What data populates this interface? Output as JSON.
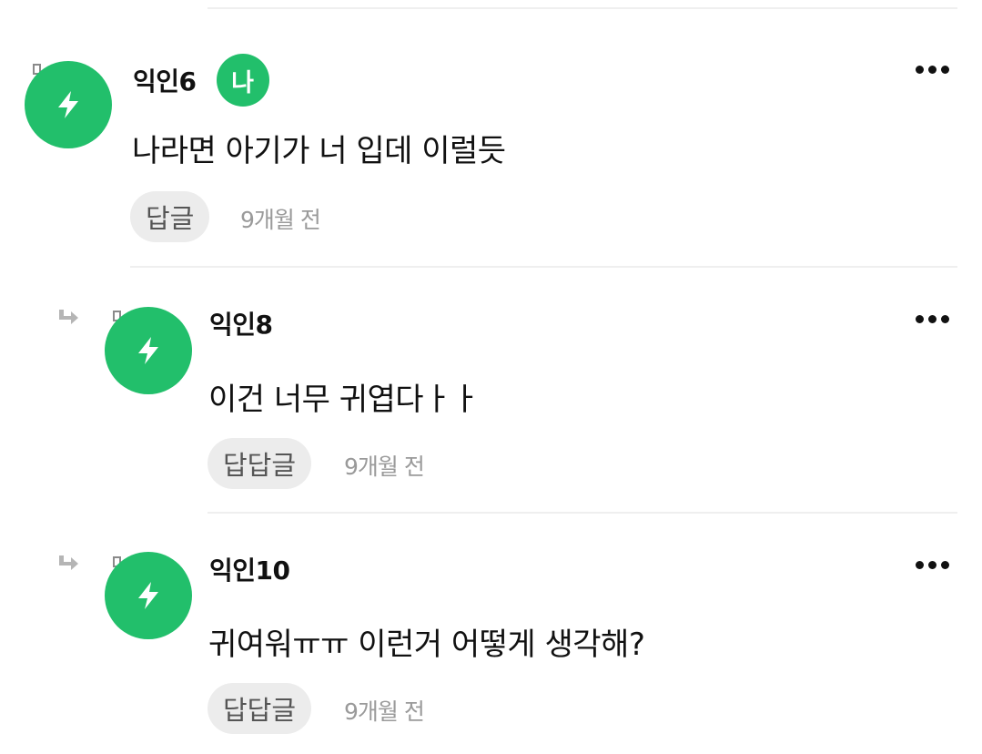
{
  "comments": [
    {
      "author": "익인6",
      "badge": "나",
      "text": "나라면 아기가 너 입데 이럴듯",
      "reply_label": "답글",
      "time": "9개월 전"
    },
    {
      "author": "익인8",
      "text": "이건 너무 귀엽다ㅏㅏ",
      "reply_label": "답답글",
      "time": "9개월 전"
    },
    {
      "author": "익인10",
      "text": "귀여워ㅠㅠ 이런거 어떻게 생각해?",
      "reply_label": "답답글",
      "time": "9개월 전"
    }
  ],
  "icons": {
    "avatar": "lightning-icon",
    "tag": "tag-icon",
    "reply_indicator": "reply-arrow-icon",
    "more": "more-dots-icon"
  },
  "colors": {
    "accent": "#22bf6b",
    "reply_button_bg": "#ececec",
    "time_text": "#9a9a9a"
  }
}
